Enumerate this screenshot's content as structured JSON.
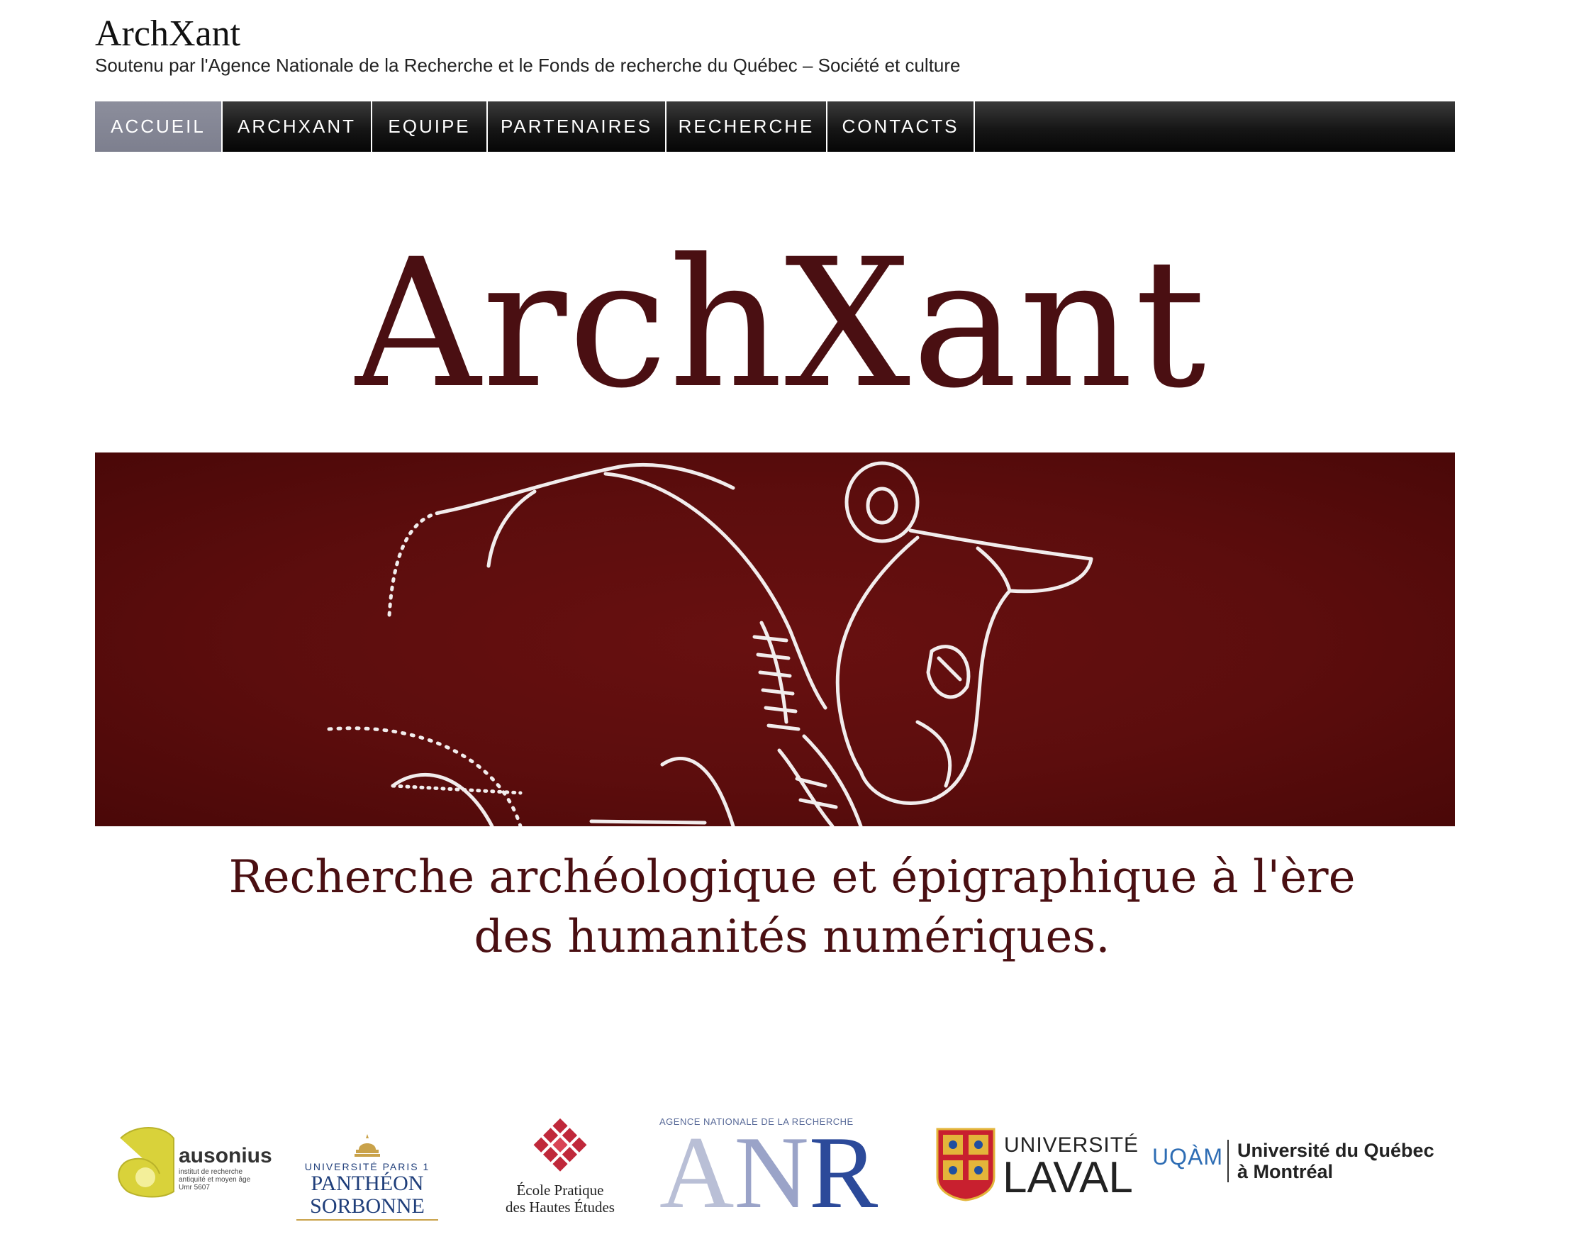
{
  "site": {
    "title": "ArchXant",
    "description": "Soutenu par l'Agence Nationale de la Recherche et le Fonds de recherche du Québec – Société et culture"
  },
  "nav": {
    "items": [
      {
        "label": "ACCUEIL",
        "active": true
      },
      {
        "label": "ARCHXANT",
        "active": false
      },
      {
        "label": "EQUIPE",
        "active": false
      },
      {
        "label": "PARTENAIRES",
        "active": false
      },
      {
        "label": "RECHERCHE",
        "active": false
      },
      {
        "label": "CONTACTS",
        "active": false
      }
    ],
    "active_color": "#7f8190",
    "bar_color": "#111111"
  },
  "banner": {
    "logo_text": "ArchXant",
    "tagline_line1": "Recherche archéologique et épigraphique à l'ère",
    "tagline_line2": "des humanités numériques.",
    "band_color": "#5e0d0d",
    "text_color": "#4a0f12",
    "image": "bull-petroglyph-drawing"
  },
  "partners": {
    "ausonius": {
      "name": "ausonius",
      "sub1": "institut de recherche",
      "sub2": "antiquité et moyen âge",
      "sub3": "Umr 5607"
    },
    "sorbonne": {
      "small": "UNIVERSITÉ PARIS 1",
      "big": "PANTHÉON SORBONNE"
    },
    "ephe": {
      "line1": "École Pratique",
      "line2": "des Hautes Études"
    },
    "anr": {
      "top": "AGENCE NATIONALE DE LA RECHERCHE",
      "a": "A",
      "n": "N",
      "r": "R"
    },
    "laval": {
      "line1": "UNIVERSITÉ",
      "line2": "LAVAL"
    },
    "uqam": {
      "mark": "UQÀM",
      "line1": "Université du Québec",
      "line2": "à Montréal"
    }
  }
}
